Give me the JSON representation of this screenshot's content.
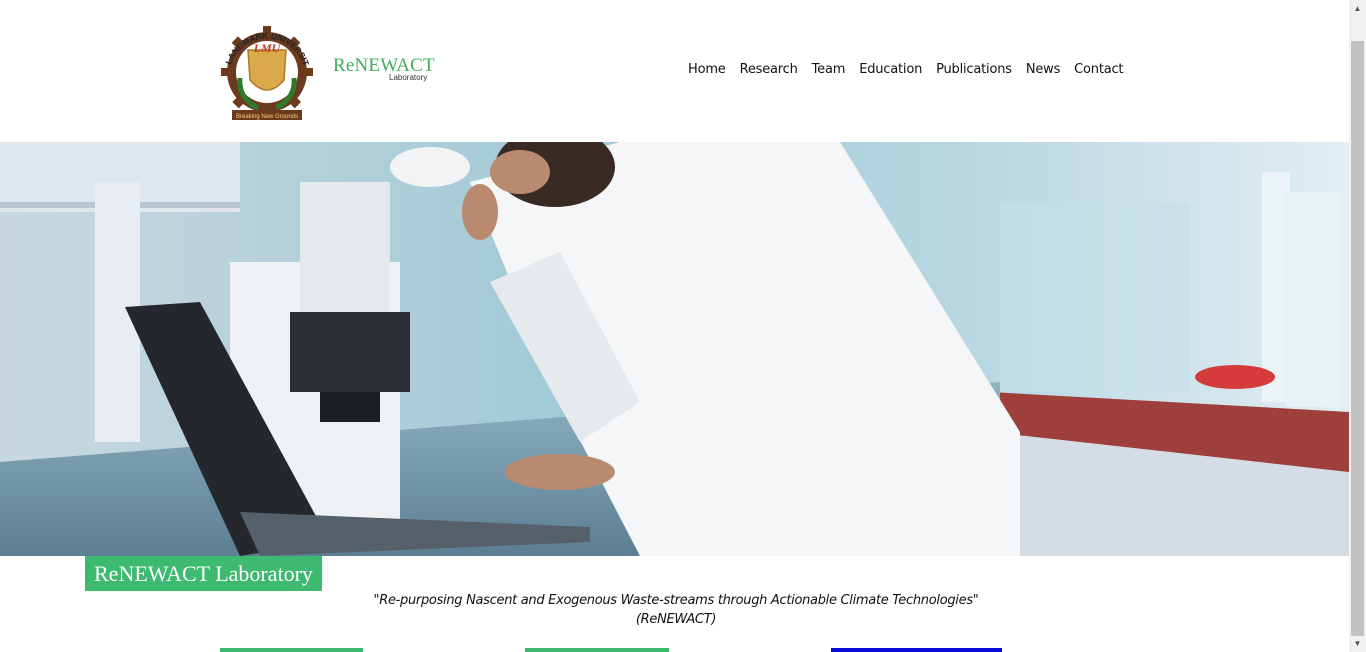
{
  "header": {
    "logo_alt": "Landmark University logo",
    "logo_text_top": "LANDMARK UNIVERSITY",
    "logo_text_center": "LMU",
    "logo_text_ribbon": "Breaking New Grounds",
    "brand_name": "ReNEWACT",
    "brand_sub": "Laboratory"
  },
  "nav": {
    "items": [
      "Home",
      "Research",
      "Team",
      "Education",
      "Publications",
      "News",
      "Contact"
    ]
  },
  "hero": {
    "badge": "ReNEWACT Laboratory",
    "tagline_line1": "\"Re-purposing Nascent and Exogenous Waste-streams through Actionable Climate Technologies\"",
    "tagline_line2": "(ReNEWACT)"
  },
  "colors": {
    "accent_green": "#3dba6f",
    "brand_green": "#3fae5b",
    "cta_blue": "#0a0ad8"
  },
  "icons": {
    "scroll_up": "▲",
    "scroll_down": "▼"
  }
}
